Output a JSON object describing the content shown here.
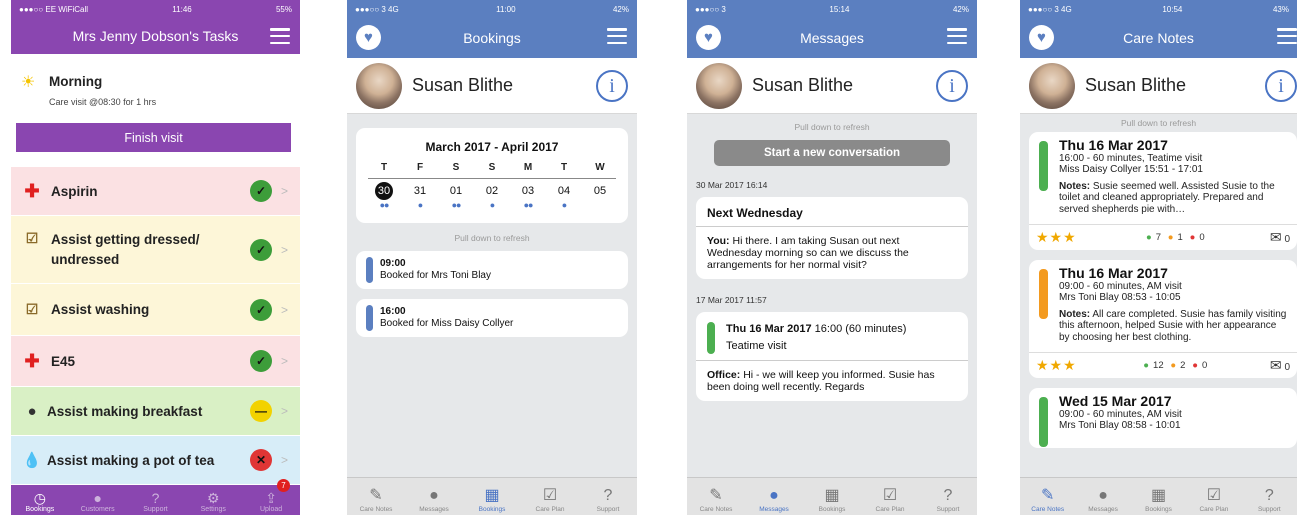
{
  "phone1": {
    "status": {
      "left": "●●●○○ EE WiFiCall",
      "time": "11:46",
      "right": "55%"
    },
    "title": "Mrs Jenny Dobson's Tasks",
    "visit": {
      "label": "Morning",
      "detail": "Care visit @08:30 for 1 hrs",
      "button": "Finish visit"
    },
    "tasks": [
      {
        "label": "Aspirin",
        "status": "✓",
        "bg": "#fbe1e3"
      },
      {
        "label": "Assist getting dressed/ undressed",
        "status": "✓",
        "bg": "#fdf6d8"
      },
      {
        "label": "Assist washing",
        "status": "✓",
        "bg": "#fdf6d8"
      },
      {
        "label": "E45",
        "status": "✓",
        "bg": "#fbe1e3"
      },
      {
        "label": "Assist making breakfast",
        "status": "—",
        "bg": "#d9f0c5"
      },
      {
        "label": "Assist making a pot of tea",
        "status": "✕",
        "bg": "#d7edf8"
      }
    ],
    "tabs": [
      "Bookings",
      "Customers",
      "Support",
      "Settings",
      "Upload"
    ],
    "upload_badge": "7"
  },
  "phone2": {
    "status": {
      "left": "●●●○○ 3  4G",
      "time": "11:00",
      "right": "42%"
    },
    "title": "Bookings",
    "patient": "Susan Blithe",
    "calendar": {
      "month": "March 2017 - April 2017",
      "days": [
        "T",
        "F",
        "S",
        "S",
        "M",
        "T",
        "W"
      ],
      "dates": [
        "30",
        "31",
        "01",
        "02",
        "03",
        "04",
        "05"
      ],
      "dots": [
        "●●",
        "●",
        "●●",
        "●",
        "●●",
        "●",
        ""
      ]
    },
    "pull": "Pull down to refresh",
    "bookings": [
      {
        "time": "09:00",
        "desc": "Booked for Mrs Toni Blay"
      },
      {
        "time": "16:00",
        "desc": "Booked for Miss Daisy Collyer"
      }
    ],
    "tabs": [
      "Care Notes",
      "Messages",
      "Bookings",
      "Care Plan",
      "Support"
    ]
  },
  "phone3": {
    "status": {
      "left": "●●●○○ 3",
      "time": "15:14",
      "right": "42%"
    },
    "title": "Messages",
    "patient": "Susan Blithe",
    "pull": "Pull down to refresh",
    "new_button": "Start a new conversation",
    "msg1": {
      "date": "30 Mar 2017 16:14",
      "subject": "Next Wednesday",
      "from": "You:",
      "body": "Hi there. I am taking Susan out next Wednesday morning so can we discuss the arrangements for her normal visit?"
    },
    "msg2": {
      "date": "17 Mar 2017 11:57",
      "head_bold": "Thu 16 Mar 2017",
      "head_rest": "16:00 (60 minutes)",
      "sub": "Teatime visit",
      "from": "Office:",
      "body": "Hi - we will keep you informed. Susie has been doing well recently. Regards"
    },
    "tabs": [
      "Care Notes",
      "Messages",
      "Bookings",
      "Care Plan",
      "Support"
    ]
  },
  "phone4": {
    "status": {
      "left": "●●●○○ 3  4G",
      "time": "10:54",
      "right": "43%"
    },
    "title": "Care Notes",
    "patient": "Susan Blithe",
    "pull": "Pull down to refresh",
    "notes": [
      {
        "date": "Thu 16 Mar 2017",
        "line1": "16:00 - 60 minutes, Teatime visit",
        "line2": "Miss Daisy Collyer 15:51 - 17:01",
        "label": "Notes:",
        "text": "Susie seemed well. Assisted Susie to the toilet and cleaned appropriately. Prepared and served shepherds pie with…",
        "green": "7",
        "orange": "1",
        "red": "0",
        "mail": "0",
        "color": "#4caf50"
      },
      {
        "date": "Thu 16 Mar 2017",
        "line1": "09:00 - 60 minutes, AM visit",
        "line2": "Mrs Toni Blay 08:53 - 10:05",
        "label": "Notes:",
        "text": "All care completed. Susie has family visiting this afternoon, helped Susie with her appearance by choosing her best clothing.",
        "green": "12",
        "orange": "2",
        "red": "0",
        "mail": "0",
        "color": "#f39a1f"
      },
      {
        "date": "Wed 15 Mar 2017",
        "line1": "09:00 - 60 minutes, AM visit",
        "line2": "Mrs Toni Blay 08:58 - 10:01",
        "color": "#4caf50"
      }
    ],
    "stars": "★★★",
    "tabs": [
      "Care Notes",
      "Messages",
      "Bookings",
      "Care Plan",
      "Support"
    ]
  }
}
